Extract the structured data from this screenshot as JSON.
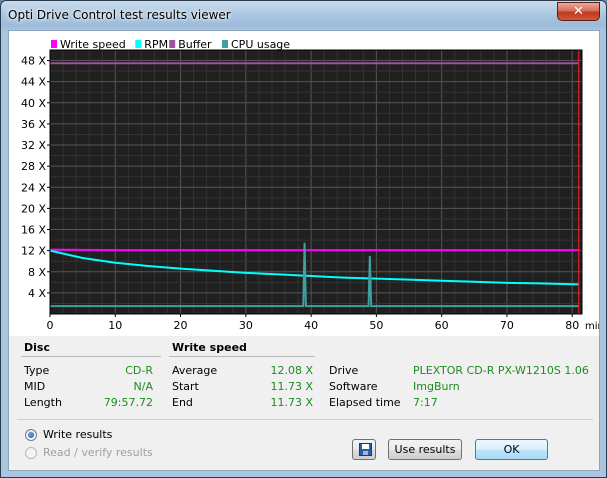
{
  "window": {
    "title": "Opti Drive Control test results viewer",
    "close_label": "✕"
  },
  "legend": [
    {
      "label": "Write speed",
      "color": "#ff00ff"
    },
    {
      "label": "RPM",
      "color": "#00ffff"
    },
    {
      "label": "Buffer",
      "color": "#a050a0"
    },
    {
      "label": "CPU usage",
      "color": "#40a0a0"
    }
  ],
  "chart_data": {
    "type": "line",
    "background": "#202020",
    "grid": true,
    "xlabel_unit": "min",
    "x_ticks": [
      "0",
      "10",
      "20",
      "30",
      "40",
      "50",
      "60",
      "70",
      "80"
    ],
    "y_ticks": [
      "4 X",
      "8 X",
      "12 X",
      "16 X",
      "20 X",
      "24 X",
      "28 X",
      "32 X",
      "36 X",
      "40 X",
      "44 X",
      "48 X"
    ],
    "xlim": [
      0,
      81.5
    ],
    "ylim": [
      0,
      50
    ],
    "end_marker_x": 81,
    "series": [
      {
        "name": "Buffer",
        "color": "#a050a0",
        "points": [
          [
            0,
            47.5
          ],
          [
            81,
            47.5
          ]
        ]
      },
      {
        "name": "Write speed",
        "color": "#ff00ff",
        "points": [
          [
            0,
            12.2
          ],
          [
            10,
            12.1
          ],
          [
            20,
            12.1
          ],
          [
            30,
            12.1
          ],
          [
            40,
            12.1
          ],
          [
            50,
            12.1
          ],
          [
            60,
            12.1
          ],
          [
            70,
            12.1
          ],
          [
            81,
            12.1
          ]
        ]
      },
      {
        "name": "RPM",
        "color": "#00ffff",
        "points": [
          [
            0,
            12.0
          ],
          [
            5,
            10.6
          ],
          [
            10,
            9.7
          ],
          [
            15,
            9.1
          ],
          [
            20,
            8.6
          ],
          [
            25,
            8.2
          ],
          [
            30,
            7.8
          ],
          [
            35,
            7.5
          ],
          [
            40,
            7.2
          ],
          [
            45,
            6.9
          ],
          [
            50,
            6.7
          ],
          [
            55,
            6.5
          ],
          [
            60,
            6.3
          ],
          [
            65,
            6.1
          ],
          [
            70,
            5.9
          ],
          [
            75,
            5.8
          ],
          [
            81,
            5.6
          ]
        ]
      },
      {
        "name": "CPU usage",
        "color": "#40a0a0",
        "points": [
          [
            0,
            1.5
          ],
          [
            10,
            1.5
          ],
          [
            20,
            1.5
          ],
          [
            30,
            1.5
          ],
          [
            38.8,
            1.5
          ],
          [
            39,
            13.5
          ],
          [
            39.2,
            1.5
          ],
          [
            48.8,
            1.5
          ],
          [
            49,
            11.0
          ],
          [
            49.2,
            1.5
          ],
          [
            60,
            1.5
          ],
          [
            70,
            1.5
          ],
          [
            81,
            1.5
          ]
        ]
      }
    ]
  },
  "disc": {
    "heading": "Disc",
    "rows": [
      {
        "label": "Type",
        "value": "CD-R"
      },
      {
        "label": "MID",
        "value": "N/A"
      },
      {
        "label": "Length",
        "value": "79:57.72"
      }
    ]
  },
  "write_speed": {
    "heading": "Write speed",
    "rows": [
      {
        "label": "Average",
        "value": "12.08 X"
      },
      {
        "label": "Start",
        "value": "11.73 X"
      },
      {
        "label": "End",
        "value": "11.73 X"
      }
    ]
  },
  "drive_info": {
    "rows": [
      {
        "label": "Drive",
        "value": "PLEXTOR  CD-R   PX-W1210S 1.06"
      },
      {
        "label": "Software",
        "value": "ImgBurn"
      },
      {
        "label": "Elapsed time",
        "value": "7:17"
      }
    ]
  },
  "options": {
    "write_results": "Write results",
    "read_verify_results": "Read / verify results",
    "selected": "write_results"
  },
  "buttons": {
    "save_icon": "floppy-disk-icon",
    "use_results": "Use results",
    "ok": "OK"
  }
}
